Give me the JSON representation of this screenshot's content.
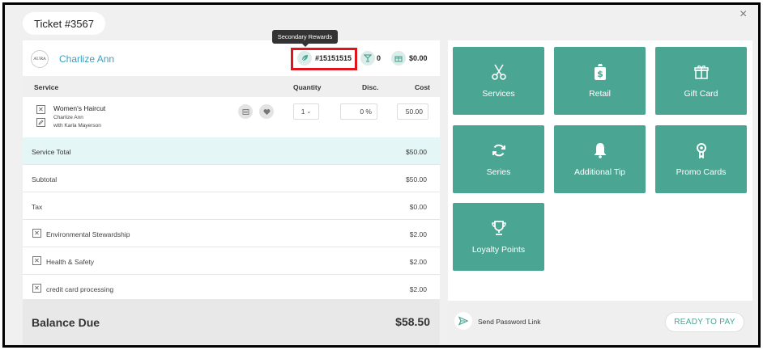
{
  "ticket": {
    "label": "Ticket #3567",
    "close_glyph": "×"
  },
  "customer": {
    "avatar_text": "AURA",
    "name": "Charlize Ann",
    "tooltip": "Secondary Rewards",
    "secondary_id": "#15151515",
    "cup_count": "0",
    "gift_amount": "$0.00"
  },
  "table": {
    "headers": {
      "service": "Service",
      "quantity": "Quantity",
      "disc": "Disc.",
      "cost": "Cost"
    },
    "items": [
      {
        "name": "Women's Haircut",
        "client": "Charlize Ann",
        "staff": "with Karla Mayerson",
        "quantity": "1",
        "disc": "0 %",
        "cost": "50.00"
      }
    ]
  },
  "summary": {
    "service_total": {
      "label": "Service Total",
      "value": "$50.00"
    },
    "subtotal": {
      "label": "Subtotal",
      "value": "$50.00"
    },
    "tax": {
      "label": "Tax",
      "value": "$0.00"
    },
    "fees": [
      {
        "label": "Environmental Stewardship",
        "value": "$2.00"
      },
      {
        "label": "Health & Safety",
        "value": "$2.00"
      },
      {
        "label": "credit card processing",
        "value": "$2.00"
      }
    ],
    "balance_due": {
      "label": "Balance Due",
      "value": "$58.50"
    }
  },
  "tiles": [
    {
      "label": "Services",
      "icon": "scissors-icon"
    },
    {
      "label": "Retail",
      "icon": "shopping-bag-icon"
    },
    {
      "label": "Gift Card",
      "icon": "gift-icon"
    },
    {
      "label": "Series",
      "icon": "refresh-icon"
    },
    {
      "label": "Additional Tip",
      "icon": "bell-icon"
    },
    {
      "label": "Promo Cards",
      "icon": "award-icon"
    },
    {
      "label": "Loyalty Points",
      "icon": "trophy-icon"
    }
  ],
  "footer": {
    "send_link": "Send Password Link",
    "ready": "READY TO PAY"
  },
  "colors": {
    "accent": "#4aa593",
    "highlight": "#e0141a",
    "link": "#3a9fc0"
  }
}
